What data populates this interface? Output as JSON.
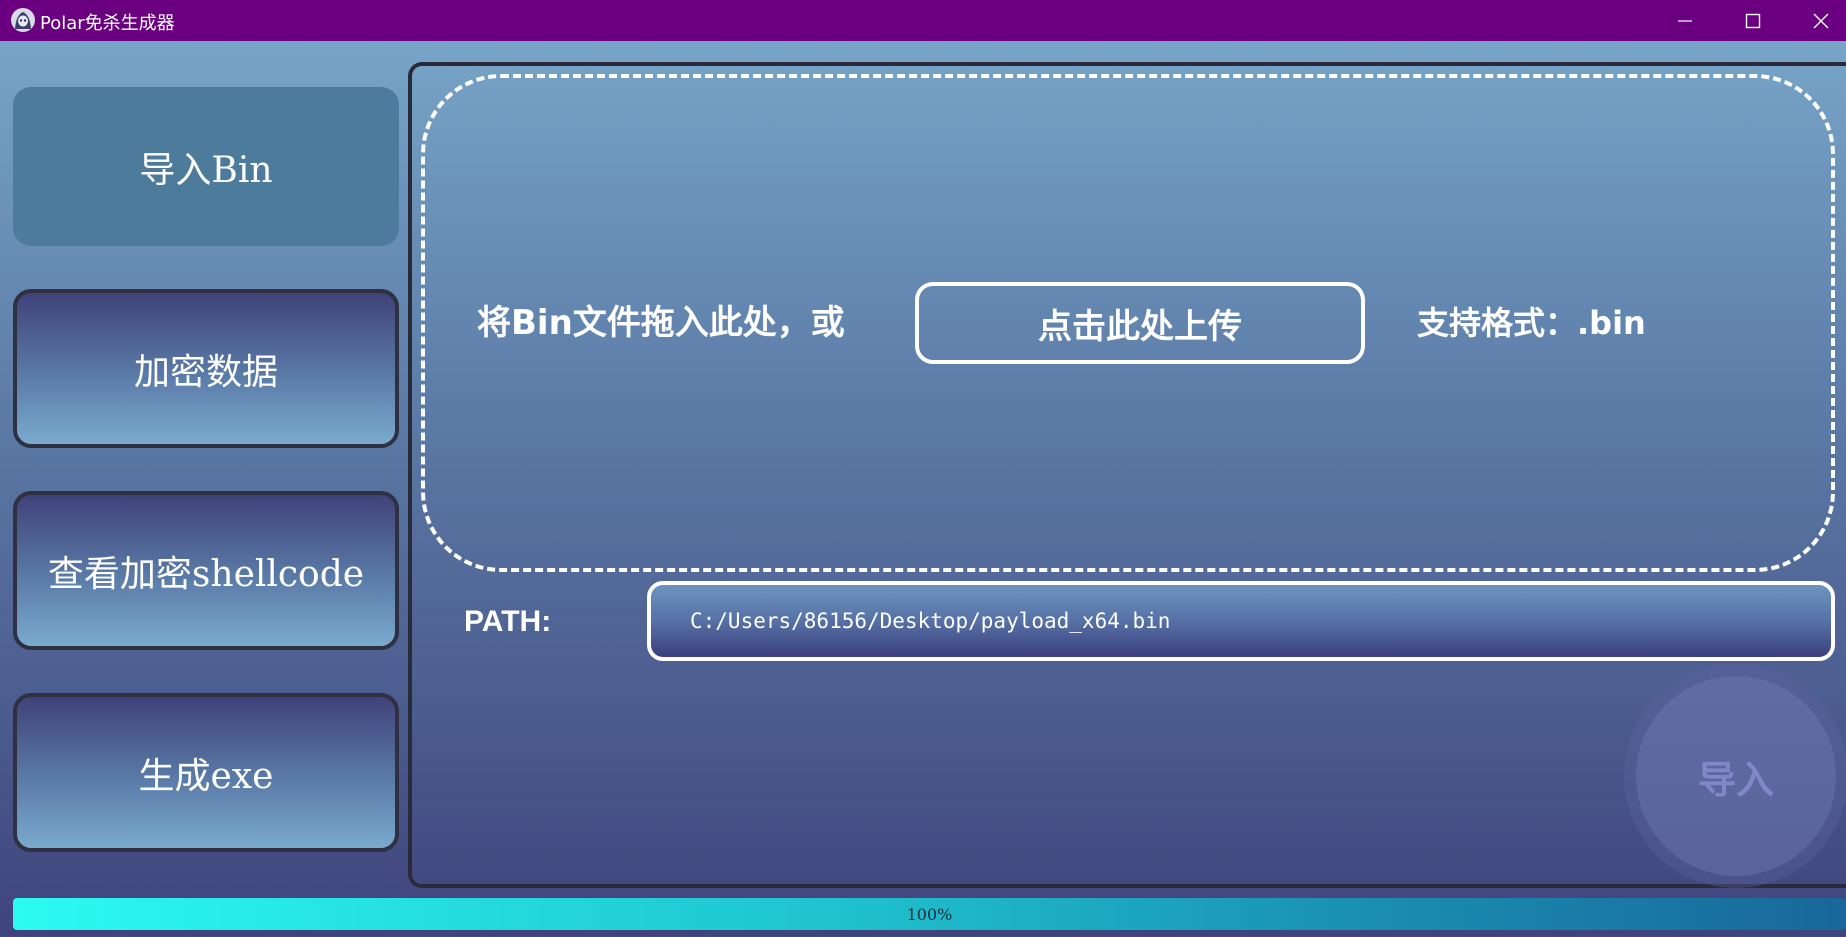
{
  "window": {
    "title": "Polar免杀生成器",
    "icon": "polar-hooded-icon",
    "controls": [
      "minimize-icon",
      "maximize-icon",
      "close-icon"
    ],
    "title_bar_color": "#6a0080"
  },
  "sidebar": {
    "items": [
      {
        "label": "导入Bin",
        "active": true
      },
      {
        "label": "加密数据",
        "active": false
      },
      {
        "label": "查看加密shellcode",
        "active": false
      },
      {
        "label": "生成exe",
        "active": false
      }
    ]
  },
  "main": {
    "drop_text": "将Bin文件拖入此处，或",
    "upload_button": "点击此处上传",
    "format_text": "支持格式：.bin",
    "path_label": "PATH:",
    "path_value": "C:/Users/86156/Desktop/payload_x64.bin",
    "import_button": "导入"
  },
  "progress": {
    "value": 1.0,
    "label": "100%"
  },
  "colors": {
    "accent_cyan": "#2bfbf1",
    "sidebar_active": "#4d7b9c"
  }
}
